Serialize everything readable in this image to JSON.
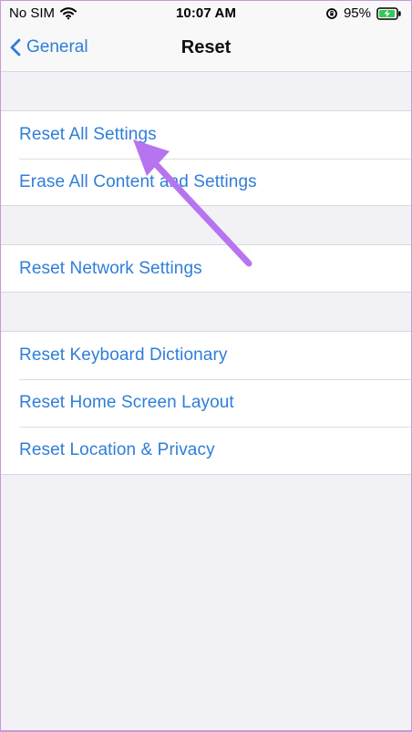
{
  "status_bar": {
    "carrier": "No SIM",
    "time": "10:07 AM",
    "battery_percent": "95%",
    "battery_level": 0.95,
    "icons": {
      "wifi": "wifi-icon",
      "orientation_lock": "orientation-lock-icon",
      "battery": "battery-charging-icon"
    }
  },
  "nav": {
    "back_label": "General",
    "title": "Reset",
    "back_icon": "chevron-left-icon"
  },
  "groups": [
    {
      "items": [
        {
          "label": "Reset All Settings"
        },
        {
          "label": "Erase All Content and Settings"
        }
      ]
    },
    {
      "items": [
        {
          "label": "Reset Network Settings"
        }
      ]
    },
    {
      "items": [
        {
          "label": "Reset Keyboard Dictionary"
        },
        {
          "label": "Reset Home Screen Layout"
        },
        {
          "label": "Reset Location & Privacy"
        }
      ]
    }
  ],
  "colors": {
    "accent_blue": "#2f7ed8",
    "background": "#f2f1f6",
    "annotation_purple": "#b774f0",
    "battery_green": "#34c759"
  },
  "annotation": {
    "type": "arrow",
    "target": "Reset All Settings"
  }
}
